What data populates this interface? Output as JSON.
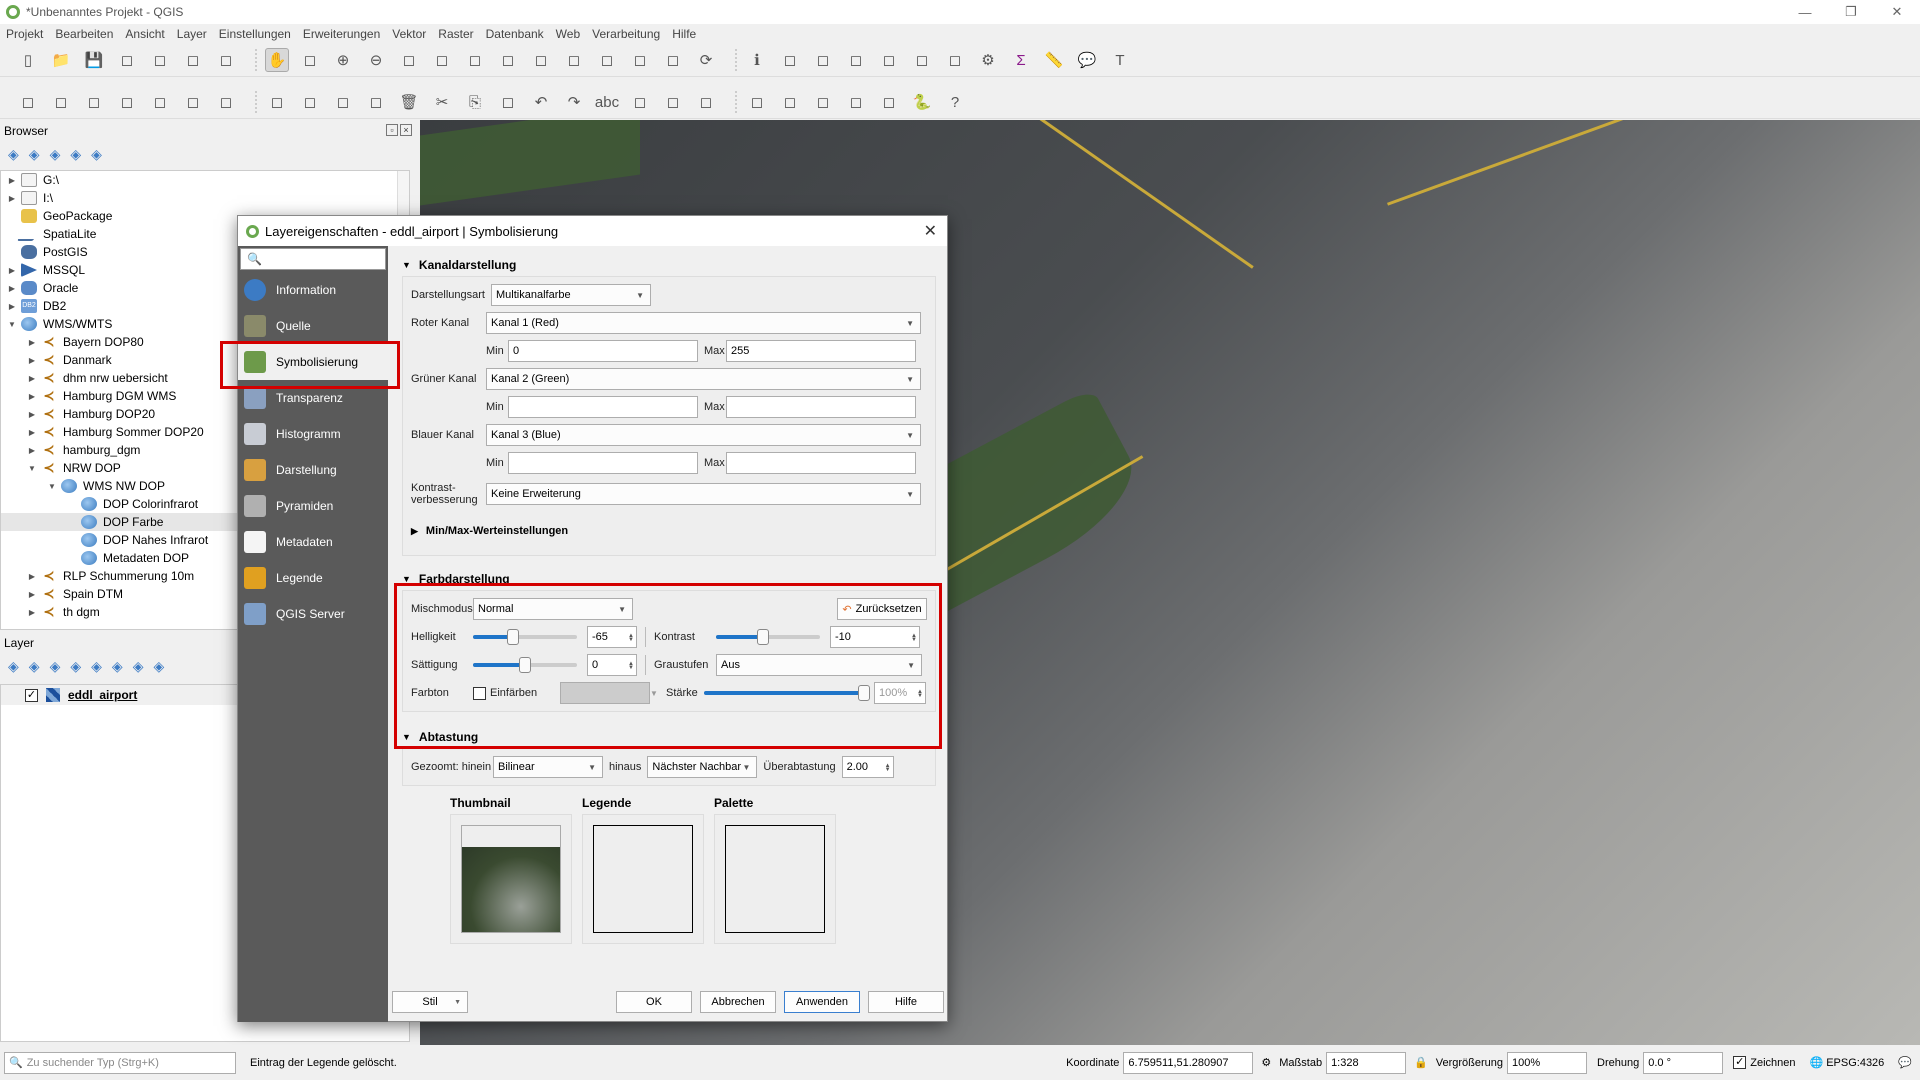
{
  "window": {
    "title": "*Unbenanntes Projekt - QGIS",
    "controls": [
      "minimize",
      "restore",
      "close"
    ]
  },
  "menu": [
    "Projekt",
    "Bearbeiten",
    "Ansicht",
    "Layer",
    "Einstellungen",
    "Erweiterungen",
    "Vektor",
    "Raster",
    "Datenbank",
    "Web",
    "Verarbeitung",
    "Hilfe"
  ],
  "toolbar1": [
    "new-project-icon",
    "open-project-icon",
    "save-project-icon",
    "save-as-icon",
    "new-print-layout-icon",
    "layout-manager-icon",
    "style-manager-icon",
    "pan-icon",
    "pan-to-selection-icon",
    "zoom-in-icon",
    "zoom-out-icon",
    "zoom-native-icon",
    "zoom-full-icon",
    "zoom-to-selection-icon",
    "zoom-to-layer-icon",
    "zoom-last-icon",
    "zoom-next-icon",
    "new-map-view-icon",
    "new-bookmark-icon",
    "show-bookmarks-icon",
    "refresh-icon",
    "identify-icon",
    "run-action-icon",
    "select-icon",
    "deselect-icon",
    "open-attribute-table-icon",
    "field-calculator-icon",
    "statistics-icon",
    "processing-toolbox-icon",
    "sum-icon",
    "measure-icon",
    "map-tips-icon",
    "text-annotation-icon"
  ],
  "toolbar2": [
    "data-source-manager-icon",
    "new-geopackage-icon",
    "new-shapefile-icon",
    "new-spatialite-icon",
    "new-temp-layer-icon",
    "current-edits-icon",
    "toggle-editing-icon",
    "save-edits-icon",
    "digitize-icon",
    "vertex-tool-icon",
    "modify-attributes-icon",
    "delete-selected-icon",
    "cut-icon",
    "copy-icon",
    "paste-icon",
    "undo-icon",
    "redo-icon",
    "label-icon",
    "diagram-icon",
    "pin-labels-icon",
    "highlight-labels-icon",
    "show-hide-labels-icon",
    "move-label-icon",
    "rotate-label-icon",
    "change-label-icon",
    "metasearch-icon",
    "python-icon",
    "help-icon"
  ],
  "browser": {
    "title": "Browser",
    "tools": [
      "add-selected-icon",
      "refresh-icon",
      "filter-icon",
      "collapse-all-icon",
      "properties-icon"
    ],
    "items": [
      {
        "label": "G:\\",
        "icon": "folder",
        "level": 0,
        "arrow": "right"
      },
      {
        "label": "I:\\",
        "icon": "folder",
        "level": 0,
        "arrow": "right"
      },
      {
        "label": "GeoPackage",
        "icon": "gpkg",
        "level": 0,
        "arrow": ""
      },
      {
        "label": "SpatiaLite",
        "icon": "sl",
        "level": 0,
        "arrow": ""
      },
      {
        "label": "PostGIS",
        "icon": "pg",
        "level": 0,
        "arrow": ""
      },
      {
        "label": "MSSQL",
        "icon": "ms",
        "level": 0,
        "arrow": "right"
      },
      {
        "label": "Oracle",
        "icon": "db",
        "level": 0,
        "arrow": "right"
      },
      {
        "label": "DB2",
        "icon": "db2",
        "level": 0,
        "arrow": "right"
      },
      {
        "label": "WMS/WMTS",
        "icon": "globe",
        "level": 0,
        "arrow": "down"
      },
      {
        "label": "Bayern DOP80",
        "icon": "wms",
        "level": 1,
        "arrow": "right"
      },
      {
        "label": "Danmark",
        "icon": "wms",
        "level": 1,
        "arrow": "right"
      },
      {
        "label": "dhm nrw uebersicht",
        "icon": "wms",
        "level": 1,
        "arrow": "right"
      },
      {
        "label": "Hamburg DGM WMS",
        "icon": "wms",
        "level": 1,
        "arrow": "right"
      },
      {
        "label": "Hamburg DOP20",
        "icon": "wms",
        "level": 1,
        "arrow": "right"
      },
      {
        "label": "Hamburg Sommer DOP20",
        "icon": "wms",
        "level": 1,
        "arrow": "right"
      },
      {
        "label": "hamburg_dgm",
        "icon": "wms",
        "level": 1,
        "arrow": "right"
      },
      {
        "label": "NRW DOP",
        "icon": "wms",
        "level": 1,
        "arrow": "down"
      },
      {
        "label": "WMS NW DOP",
        "icon": "globe",
        "level": 2,
        "arrow": "down"
      },
      {
        "label": "DOP Colorinfrarot",
        "icon": "globe",
        "level": 3,
        "arrow": ""
      },
      {
        "label": "DOP Farbe",
        "icon": "globe",
        "level": 3,
        "arrow": "",
        "selected": true
      },
      {
        "label": "DOP Nahes Infrarot",
        "icon": "globe",
        "level": 3,
        "arrow": ""
      },
      {
        "label": "Metadaten DOP",
        "icon": "globe",
        "level": 3,
        "arrow": ""
      },
      {
        "label": "RLP Schummerung 10m",
        "icon": "wms",
        "level": 1,
        "arrow": "right"
      },
      {
        "label": "Spain DTM",
        "icon": "wms",
        "level": 1,
        "arrow": "right"
      },
      {
        "label": "th dgm",
        "icon": "wms",
        "level": 1,
        "arrow": "right"
      }
    ]
  },
  "layers": {
    "title": "Layer",
    "tools": [
      "style-icon",
      "add-group-icon",
      "visibility-icon",
      "filter-legend-icon",
      "filter-expression-icon",
      "expand-all-icon",
      "collapse-all-icon",
      "remove-layer-icon"
    ],
    "items": [
      {
        "label": "eddl_airport",
        "checked": true
      }
    ]
  },
  "dialog": {
    "title": "Layereigenschaften - eddl_airport | Symbolisierung",
    "search_placeholder": "",
    "nav": [
      {
        "label": "Information",
        "icon": "information-icon",
        "color": "#3c7bc4"
      },
      {
        "label": "Quelle",
        "icon": "source-icon",
        "color": "#8a8a6a"
      },
      {
        "label": "Symbolisierung",
        "icon": "symbology-icon",
        "color": "#6d9a4a",
        "active": true
      },
      {
        "label": "Transparenz",
        "icon": "transparency-icon",
        "color": "#8aa0c0"
      },
      {
        "label": "Histogramm",
        "icon": "histogram-icon",
        "color": "#c8ccd4"
      },
      {
        "label": "Darstellung",
        "icon": "rendering-icon",
        "color": "#d8a040"
      },
      {
        "label": "Pyramiden",
        "icon": "pyramids-icon",
        "color": "#b0b0b0"
      },
      {
        "label": "Metadaten",
        "icon": "metadata-icon",
        "color": "#f4f4f4"
      },
      {
        "label": "Legende",
        "icon": "legend-icon",
        "color": "#e0a020"
      },
      {
        "label": "QGIS Server",
        "icon": "qgis-server-icon",
        "color": "#7f9fc8"
      }
    ],
    "band": {
      "header": "Kanaldarstellung",
      "render_type_label": "Darstellungsart",
      "render_type": "Multikanalfarbe",
      "red_label": "Roter Kanal",
      "red": "Kanal 1 (Red)",
      "red_min": "0",
      "red_max": "255",
      "green_label": "Grüner Kanal",
      "green": "Kanal 2 (Green)",
      "green_min": "",
      "green_max": "",
      "blue_label": "Blauer Kanal",
      "blue": "Kanal 3 (Blue)",
      "blue_min": "",
      "blue_max": "",
      "min_label": "Min",
      "max_label": "Max",
      "contrast_label_1": "Kontrast-",
      "contrast_label_2": "verbesserung",
      "contrast": "Keine Erweiterung",
      "minmax_header": "Min/Max-Werteinstellungen"
    },
    "color": {
      "header": "Farbdarstellung",
      "blend_label": "Mischmodus",
      "blend": "Normal",
      "reset_label": "Zurücksetzen",
      "brightness_label": "Helligkeit",
      "brightness": "-65",
      "brightness_frac": 0.38,
      "contrast_label": "Kontrast",
      "contrast": "-10",
      "contrast_frac": 0.45,
      "saturation_label": "Sättigung",
      "saturation": "0",
      "saturation_frac": 0.5,
      "grayscale_label": "Graustufen",
      "grayscale": "Aus",
      "hue_label": "Farbton",
      "colorize_label": "Einfärben",
      "colorize_checked": false,
      "strength_label": "Stärke",
      "strength": "100%",
      "strength_frac": 1.0
    },
    "resampling": {
      "header": "Abtastung",
      "zoomed_in_label": "Gezoomt: hinein",
      "zoomed_in": "Bilinear",
      "zoomed_out_label": "hinaus",
      "zoomed_out": "Nächster Nachbar",
      "oversampling_label": "Überabtastung",
      "oversampling": "2.00"
    },
    "previews": {
      "thumbnail": "Thumbnail",
      "legend": "Legende",
      "palette": "Palette"
    },
    "buttons": {
      "style": "Stil",
      "ok": "OK",
      "cancel": "Abbrechen",
      "apply": "Anwenden",
      "help": "Hilfe"
    }
  },
  "statusbar": {
    "locator_placeholder": "Zu suchender Typ (Strg+K)",
    "message": "Eintrag der Legende gelöscht.",
    "coordinate_label": "Koordinate",
    "coordinate": "6.759511,51.280907",
    "scale_label": "Maßstab",
    "scale": "1:328",
    "magnifier_label": "Vergrößerung",
    "magnifier": "100%",
    "rotation_label": "Drehung",
    "rotation": "0.0 °",
    "render_label": "Zeichnen",
    "render_checked": true,
    "crs": "EPSG:4326"
  },
  "colors": {
    "highlight": "#d40000",
    "accent": "#1e74c8",
    "sidebar": "#5a5a5a"
  }
}
